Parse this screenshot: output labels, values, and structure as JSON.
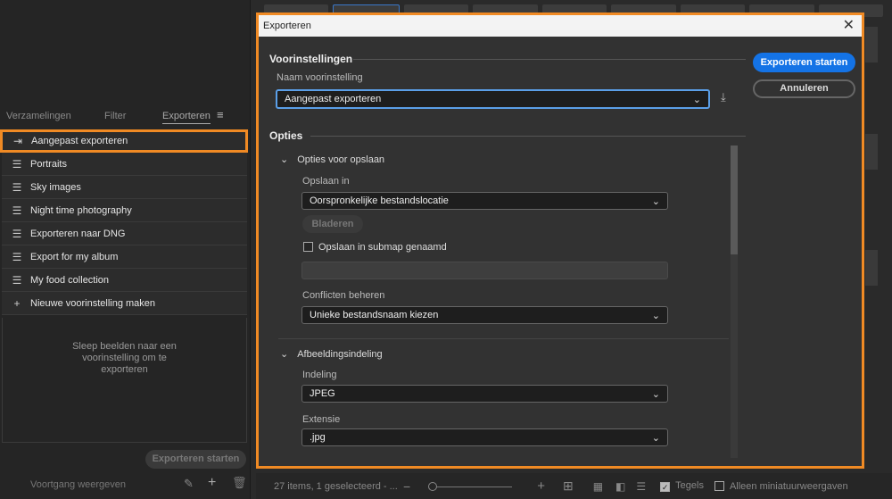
{
  "left_panel": {
    "tabs": [
      {
        "label": "Verzamelingen"
      },
      {
        "label": "Filter"
      },
      {
        "label": "Exporteren",
        "active": true
      }
    ],
    "menu_icon": "hamburger-icon",
    "presets": [
      {
        "label": "Aangepast exporteren",
        "icon": "export-icon",
        "selected": true
      },
      {
        "label": "Portraits",
        "icon": "list-icon"
      },
      {
        "label": "Sky images",
        "icon": "list-icon"
      },
      {
        "label": "Night time photography",
        "icon": "list-icon"
      },
      {
        "label": "Exporteren naar DNG",
        "icon": "list-icon"
      },
      {
        "label": "Export for my album",
        "icon": "list-icon"
      },
      {
        "label": "My food collection",
        "icon": "list-icon"
      },
      {
        "label": "Nieuwe voorinstelling maken",
        "icon": "plus-icon"
      }
    ],
    "drop_hint": "Sleep beelden naar een voorinstelling om te exporteren",
    "start_export": "Exporteren starten",
    "progress_link": "Voortgang weergeven"
  },
  "dialog": {
    "title": "Exporteren",
    "presets_heading": "Voorinstellingen",
    "preset_name_label": "Naam voorinstelling",
    "preset_name_value": "Aangepast exporteren",
    "start_button": "Exporteren starten",
    "cancel_button": "Annuleren",
    "options_heading": "Opties",
    "save_section": {
      "title": "Opties voor opslaan",
      "save_in_label": "Opslaan in",
      "save_in_value": "Oorspronkelijke bestandslocatie",
      "browse_button": "Bladeren",
      "subfolder_label": "Opslaan in submap genaamd",
      "subfolder_checked": false,
      "subfolder_value": "",
      "conflicts_label": "Conflicten beheren",
      "conflicts_value": "Unieke bestandsnaam kiezen"
    },
    "format_section": {
      "title": "Afbeeldingsindeling",
      "format_label": "Indeling",
      "format_value": "JPEG",
      "extension_label": "Extensie",
      "extension_value": ".jpg"
    }
  },
  "bottom_bar": {
    "status": "27 items, 1 geselecteerd - ...",
    "tiles_label": "Tegels",
    "tiles_checked": true,
    "thumbs_only_label": "Alleen miniatuurweergaven",
    "thumbs_only_checked": false
  },
  "colors": {
    "accent": "#1473e6",
    "highlight": "#f08a24"
  }
}
